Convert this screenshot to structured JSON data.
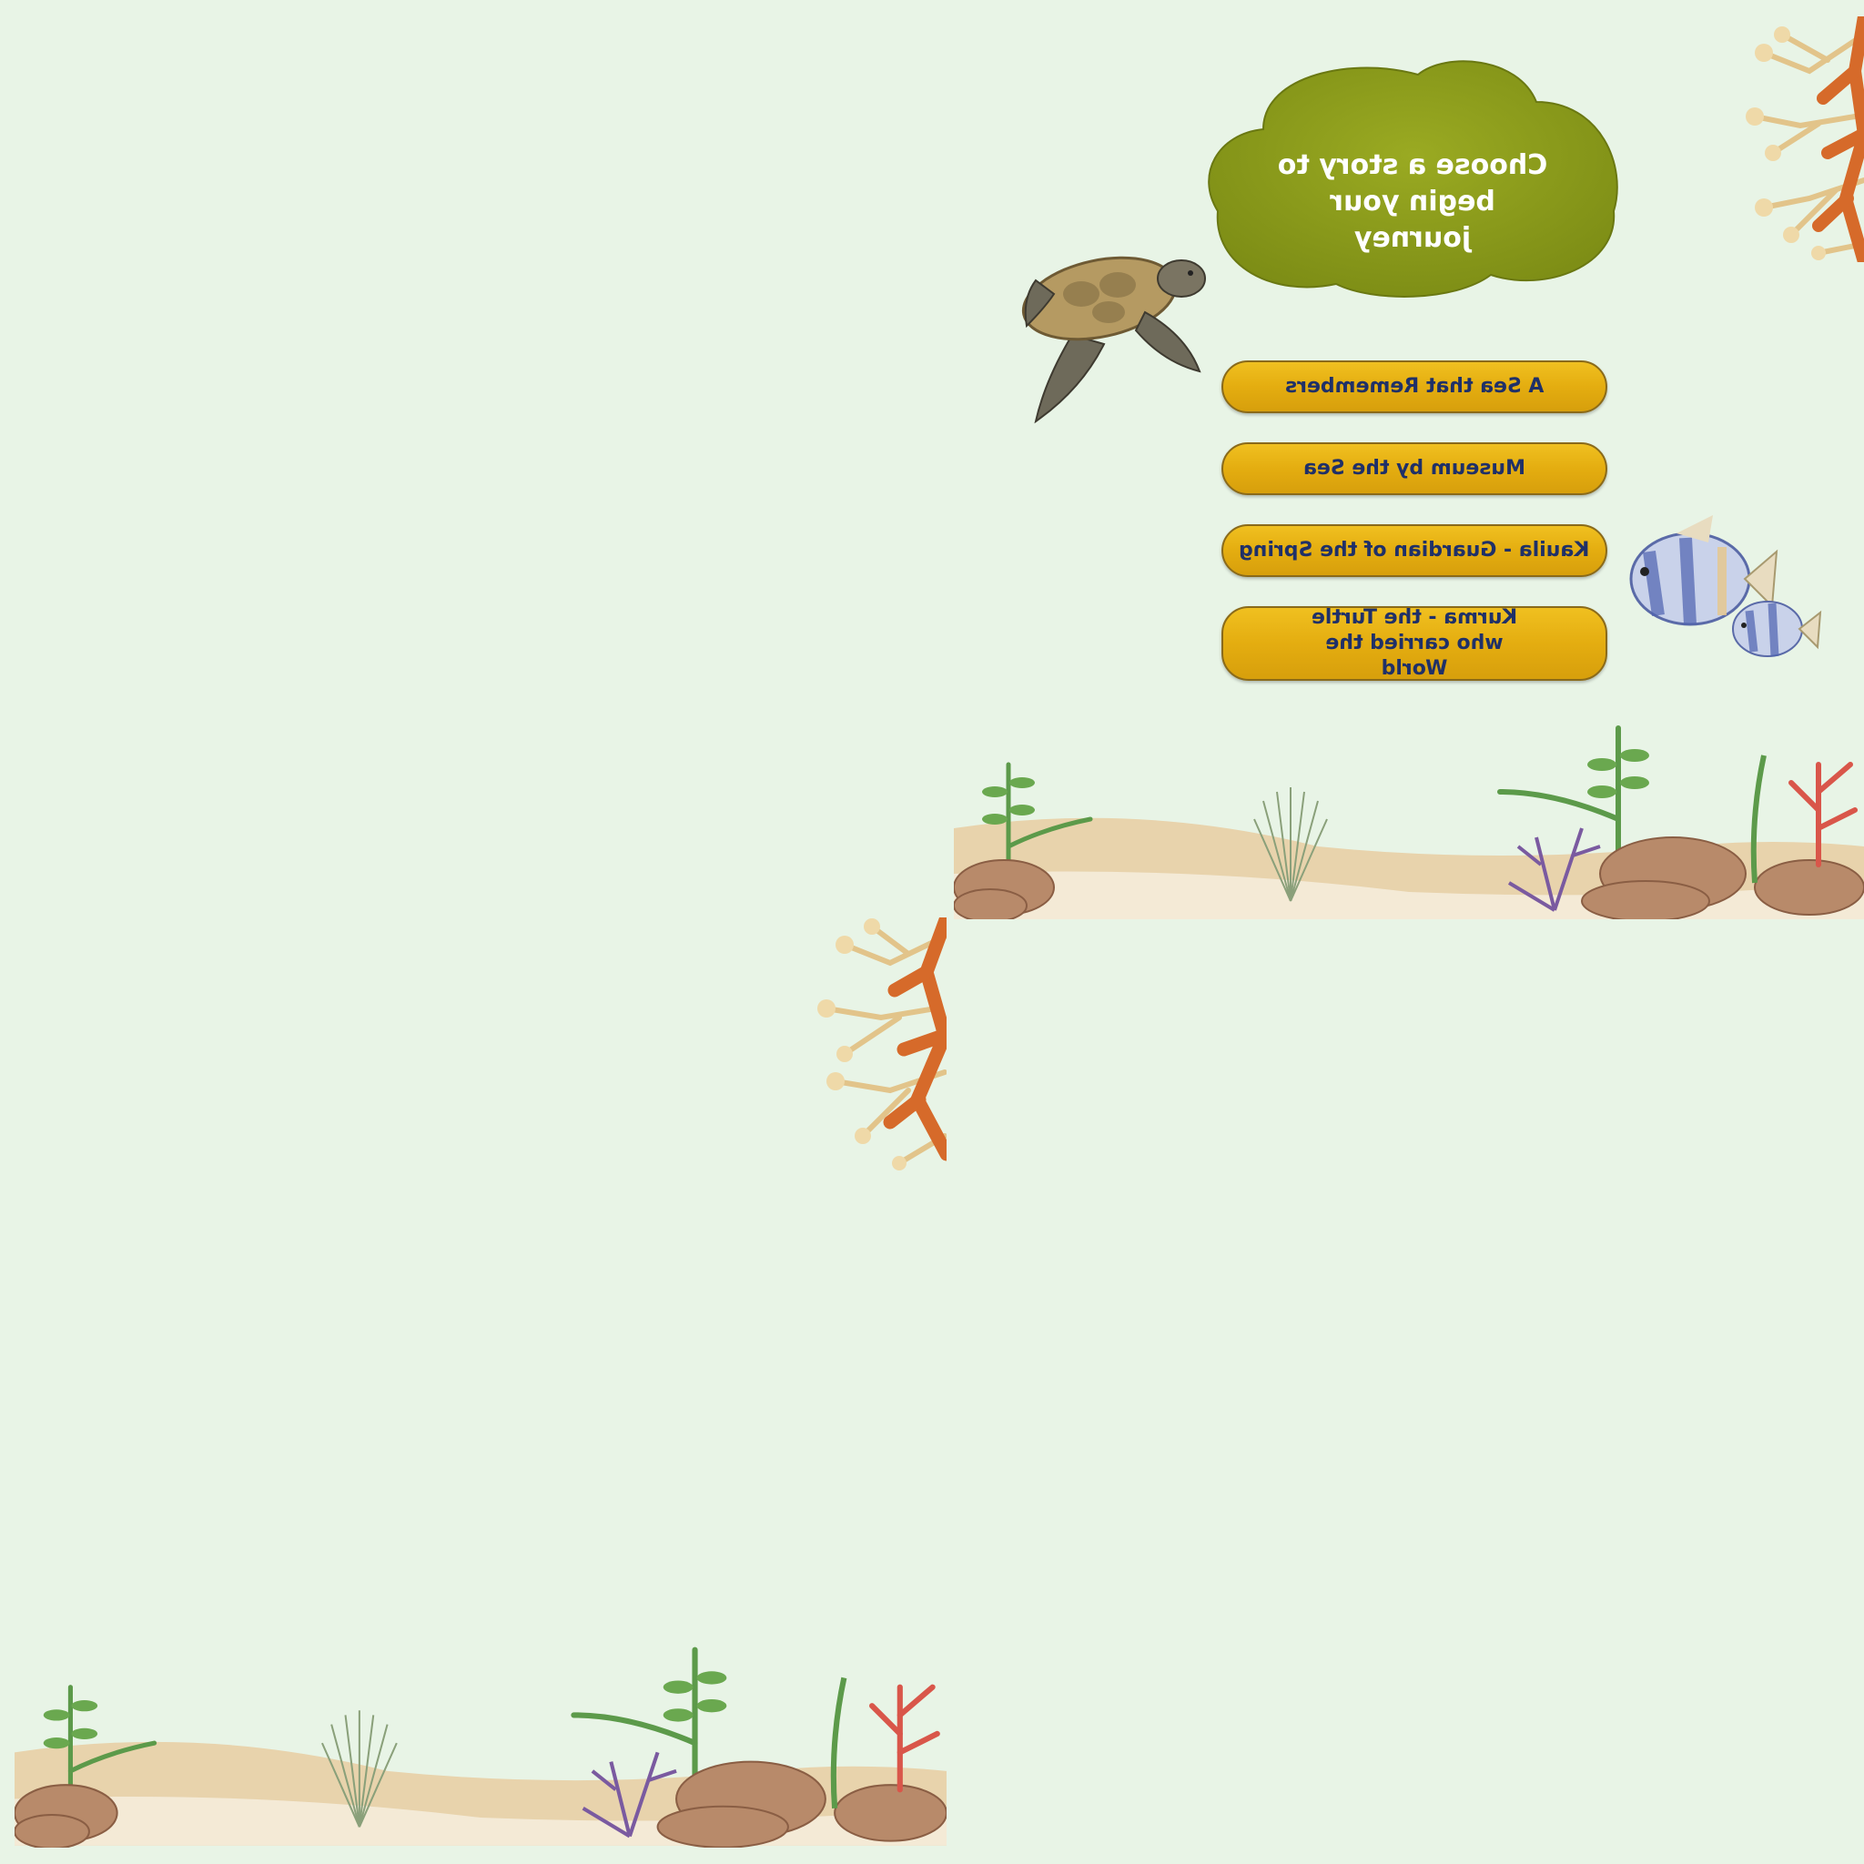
{
  "title": {
    "text": "Choose a story to begin your journey"
  },
  "stories": [
    {
      "label": "A Sea that Remembers"
    },
    {
      "label": "Museum by the Sea"
    },
    {
      "label": "Kauila - Guardian of the Spring"
    },
    {
      "label": "Kurma - the Turtle who carried the World"
    }
  ],
  "colors": {
    "background": "#e8f4e6",
    "cloud": "#8a9a1c",
    "button": "#e4ad10",
    "button_text": "#1f3068",
    "title_text": "#ffffff"
  },
  "icons": [
    "sea-turtle-icon",
    "angelfish-icon",
    "coral-icon",
    "reef-icon"
  ]
}
